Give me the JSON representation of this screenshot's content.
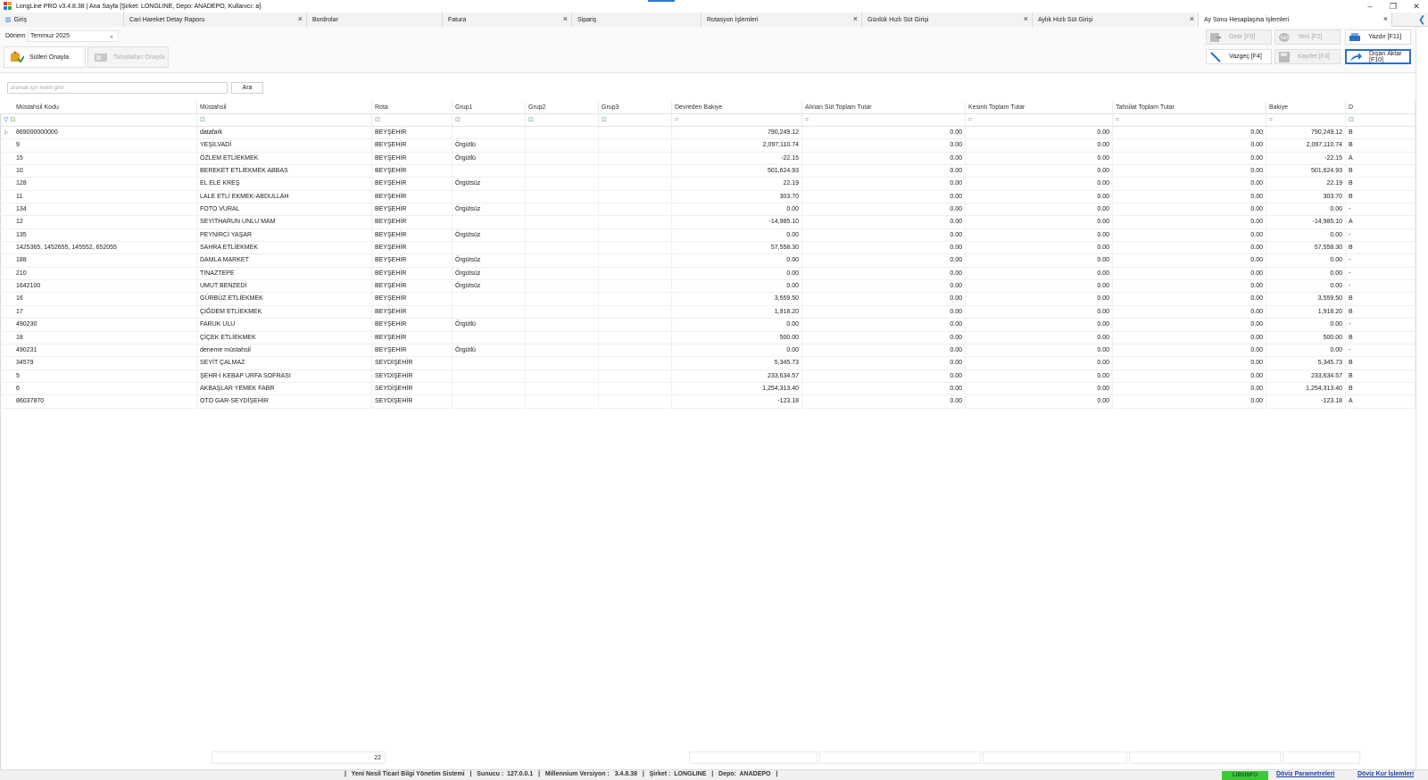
{
  "window": {
    "title": "LongLine PRO v3.4.8.38 | Ana Sayfa [Şirket: LONGLINE, Depo: ANADEPO, Kullanıcı: a]",
    "minimize": "–",
    "restore": "❐",
    "close": "✕"
  },
  "tabs": [
    {
      "label": "Giriş",
      "closable": false
    },
    {
      "label": "Cari Hareket Detay Raporu",
      "closable": true
    },
    {
      "label": "Bordrolar",
      "closable": false
    },
    {
      "label": "Fatura",
      "closable": true
    },
    {
      "label": "Sipariş",
      "closable": false
    },
    {
      "label": "Rotasyon İşlemleri",
      "closable": true
    },
    {
      "label": "Günlük Hızlı Süt Girişi",
      "closable": true
    },
    {
      "label": "Aylık Hızlı Süt Girişi",
      "closable": true
    },
    {
      "label": "Ay Sonu Hesaplaşma İşlemleri",
      "closable": true
    }
  ],
  "toolbar": {
    "donem_label": "Dönem",
    "donem_value": "Temmuz 2025",
    "sutleri_onayla": "Sütleri Onayla",
    "tahsilatlari_onayla": "Tahsilatları Onayla",
    "getir": "Getir [F9]",
    "yeni": "Yeni [F2]",
    "yazdir": "Yazdır [F11]",
    "vazgec": "Vazgeç [F4]",
    "kaydet": "Kaydet [F3]",
    "disari_aktar": "Dışarı Aktar [F10]"
  },
  "search": {
    "placeholder": "aramak için metni girin",
    "button": "Ara"
  },
  "grid": {
    "columns": [
      "Müstahsil Kodu",
      "Müstahsil",
      "Rota",
      "Grup1",
      "Grup2",
      "Grup3",
      "Devreden Bakiye",
      "Alınan Süt Toplam Tutar",
      "Kesinti Toplam Tutar",
      "Tahsilat Toplam Tutar",
      "Bakiye",
      "D"
    ],
    "filter_symbols": [
      "⊡",
      "⊡",
      "⊡",
      "⊡",
      "⊡",
      "⊡",
      "=",
      "=",
      "=",
      "=",
      "=",
      "⊡"
    ],
    "rows": [
      [
        "869000000000",
        "datafark",
        "BEYŞEHİR",
        "",
        "",
        "",
        "790,249.12",
        "0.00",
        "0.00",
        "0.00",
        "790,249.12",
        "B"
      ],
      [
        "9",
        "YEŞİLVADİ",
        "BEYŞEHİR",
        "Örgütlü",
        "",
        "",
        "2,097,110.74",
        "0.00",
        "0.00",
        "0.00",
        "2,097,110.74",
        "B"
      ],
      [
        "15",
        "ÖZLEM ETLİEKMEK",
        "BEYŞEHİR",
        "Örgütlü",
        "",
        "",
        "-22.15",
        "0.00",
        "0.00",
        "0.00",
        "-22.15",
        "A"
      ],
      [
        "10",
        "BEREKET ETLİEKMEK ABBAS",
        "BEYŞEHİR",
        "",
        "",
        "",
        "501,624.93",
        "0.00",
        "0.00",
        "0.00",
        "501,624.93",
        "B"
      ],
      [
        "128",
        "EL ELE KREŞ",
        "BEYŞEHİR",
        "Örgütsüz",
        "",
        "",
        "22.19",
        "0.00",
        "0.00",
        "0.00",
        "22.19",
        "B"
      ],
      [
        "11",
        "LALE ETLİ EKMEK-ABDULLAH",
        "BEYŞEHİR",
        "",
        "",
        "",
        "303.70",
        "0.00",
        "0.00",
        "0.00",
        "303.70",
        "B"
      ],
      [
        "134",
        "FOTO VURAL",
        "BEYŞEHİR",
        "Örgütsüz",
        "",
        "",
        "0.00",
        "0.00",
        "0.00",
        "0.00",
        "0.00",
        "-"
      ],
      [
        "12",
        "SEYİTHARUN UNLU MAM",
        "BEYŞEHİR",
        "",
        "",
        "",
        "-14,985.10",
        "0.00",
        "0.00",
        "0.00",
        "-14,985.10",
        "A"
      ],
      [
        "135",
        "PEYNİRCİ YAŞAR",
        "BEYŞEHİR",
        "Örgütsüz",
        "",
        "",
        "0.00",
        "0.00",
        "0.00",
        "0.00",
        "0.00",
        "-"
      ],
      [
        "1425365, 1452655, 145552, 652055",
        "SAHRA ETLİEKMEK",
        "BEYŞEHİR",
        "",
        "",
        "",
        "57,558.30",
        "0.00",
        "0.00",
        "0.00",
        "57,558.30",
        "B"
      ],
      [
        "188",
        "DAMLA MARKET",
        "BEYŞEHİR",
        "Örgütsüz",
        "",
        "",
        "0.00",
        "0.00",
        "0.00",
        "0.00",
        "0.00",
        "-"
      ],
      [
        "210",
        "TINAZTEPE",
        "BEYŞEHİR",
        "Örgütsüz",
        "",
        "",
        "0.00",
        "0.00",
        "0.00",
        "0.00",
        "0.00",
        "-"
      ],
      [
        "1642100",
        "UMUT BENZEDİ",
        "BEYŞEHİR",
        "Örgütsüz",
        "",
        "",
        "0.00",
        "0.00",
        "0.00",
        "0.00",
        "0.00",
        "-"
      ],
      [
        "16",
        "GÜRBÜZ ETLİEKMEK",
        "BEYŞEHİR",
        "",
        "",
        "",
        "3,559.50",
        "0.00",
        "0.00",
        "0.00",
        "3,559.50",
        "B"
      ],
      [
        "17",
        "ÇİĞDEM ETLİEKMEK",
        "BEYŞEHİR",
        "",
        "",
        "",
        "1,918.20",
        "0.00",
        "0.00",
        "0.00",
        "1,918.20",
        "B"
      ],
      [
        "490230",
        "FARUK ULU",
        "BEYŞEHİR",
        "Örgütlü",
        "",
        "",
        "0.00",
        "0.00",
        "0.00",
        "0.00",
        "0.00",
        "-"
      ],
      [
        "18",
        "ÇİÇEK ETLİEKMEK",
        "BEYŞEHİR",
        "",
        "",
        "",
        "500.00",
        "0.00",
        "0.00",
        "0.00",
        "500.00",
        "B"
      ],
      [
        "490231",
        "deneme müstahsil",
        "BEYŞEHİR",
        "Örgütlü",
        "",
        "",
        "0.00",
        "0.00",
        "0.00",
        "0.00",
        "0.00",
        "-"
      ],
      [
        "34579",
        "SEYİT ÇALMAZ",
        "SEYDİŞEHİR",
        "",
        "",
        "",
        "5,345.73",
        "0.00",
        "0.00",
        "0.00",
        "5,345.73",
        "B"
      ],
      [
        "5",
        "ŞEHR-İ KEBAP URFA SOFRASI",
        "SEYDİŞEHİR",
        "",
        "",
        "",
        "233,634.57",
        "0.00",
        "0.00",
        "0.00",
        "233,634.57",
        "B"
      ],
      [
        "6",
        "AKBAŞLAR YEMEK FABR",
        "SEYDİŞEHİR",
        "",
        "",
        "",
        "1,254,313.40",
        "0.00",
        "0.00",
        "0.00",
        "1,254,313.40",
        "B"
      ],
      [
        "86037870",
        "OTO GAR-SEYDİŞEHİR",
        "SEYDİŞEHİR",
        "",
        "",
        "",
        "-123.18",
        "0.00",
        "0.00",
        "0.00",
        "-123.18",
        "A"
      ]
    ],
    "footer_count": "22"
  },
  "statusbar": {
    "text": "|   Yeni Nesil Ticari Bilgi Yönetim Sistemi   |   Sunucu :  127.0.0.1   |   Millennium Versiyon :   3.4.8.38   |   Şirket :  LONGLINE   |   Depo:  ANADEPO   |",
    "license": "LIBSINFO",
    "doviz_param": "Döviz Parametreleri",
    "doviz_kur": "Döviz Kur İşlemleri"
  },
  "colors": {
    "accent": "#2a6fc4",
    "license_green": "#39c939",
    "filter_green": "#5aa55a"
  }
}
